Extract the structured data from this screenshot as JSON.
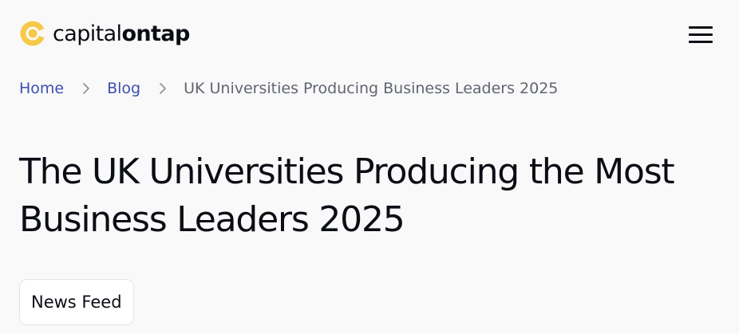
{
  "header": {
    "logo": {
      "text_light": "capital",
      "text_bold": "ontap",
      "accent_color": "#f7c948",
      "icon": "capitalontap-logo-icon"
    },
    "menu_icon": "hamburger-menu-icon"
  },
  "breadcrumb": {
    "items": [
      {
        "label": "Home"
      },
      {
        "label": "Blog"
      }
    ],
    "current": "UK Universities Producing Business Leaders 2025",
    "separator_icon": "chevron-right-icon",
    "link_color": "#3d4fb3"
  },
  "article": {
    "title": "The UK Universities Producing the Most Business Leaders 2025",
    "category": "News Feed"
  }
}
